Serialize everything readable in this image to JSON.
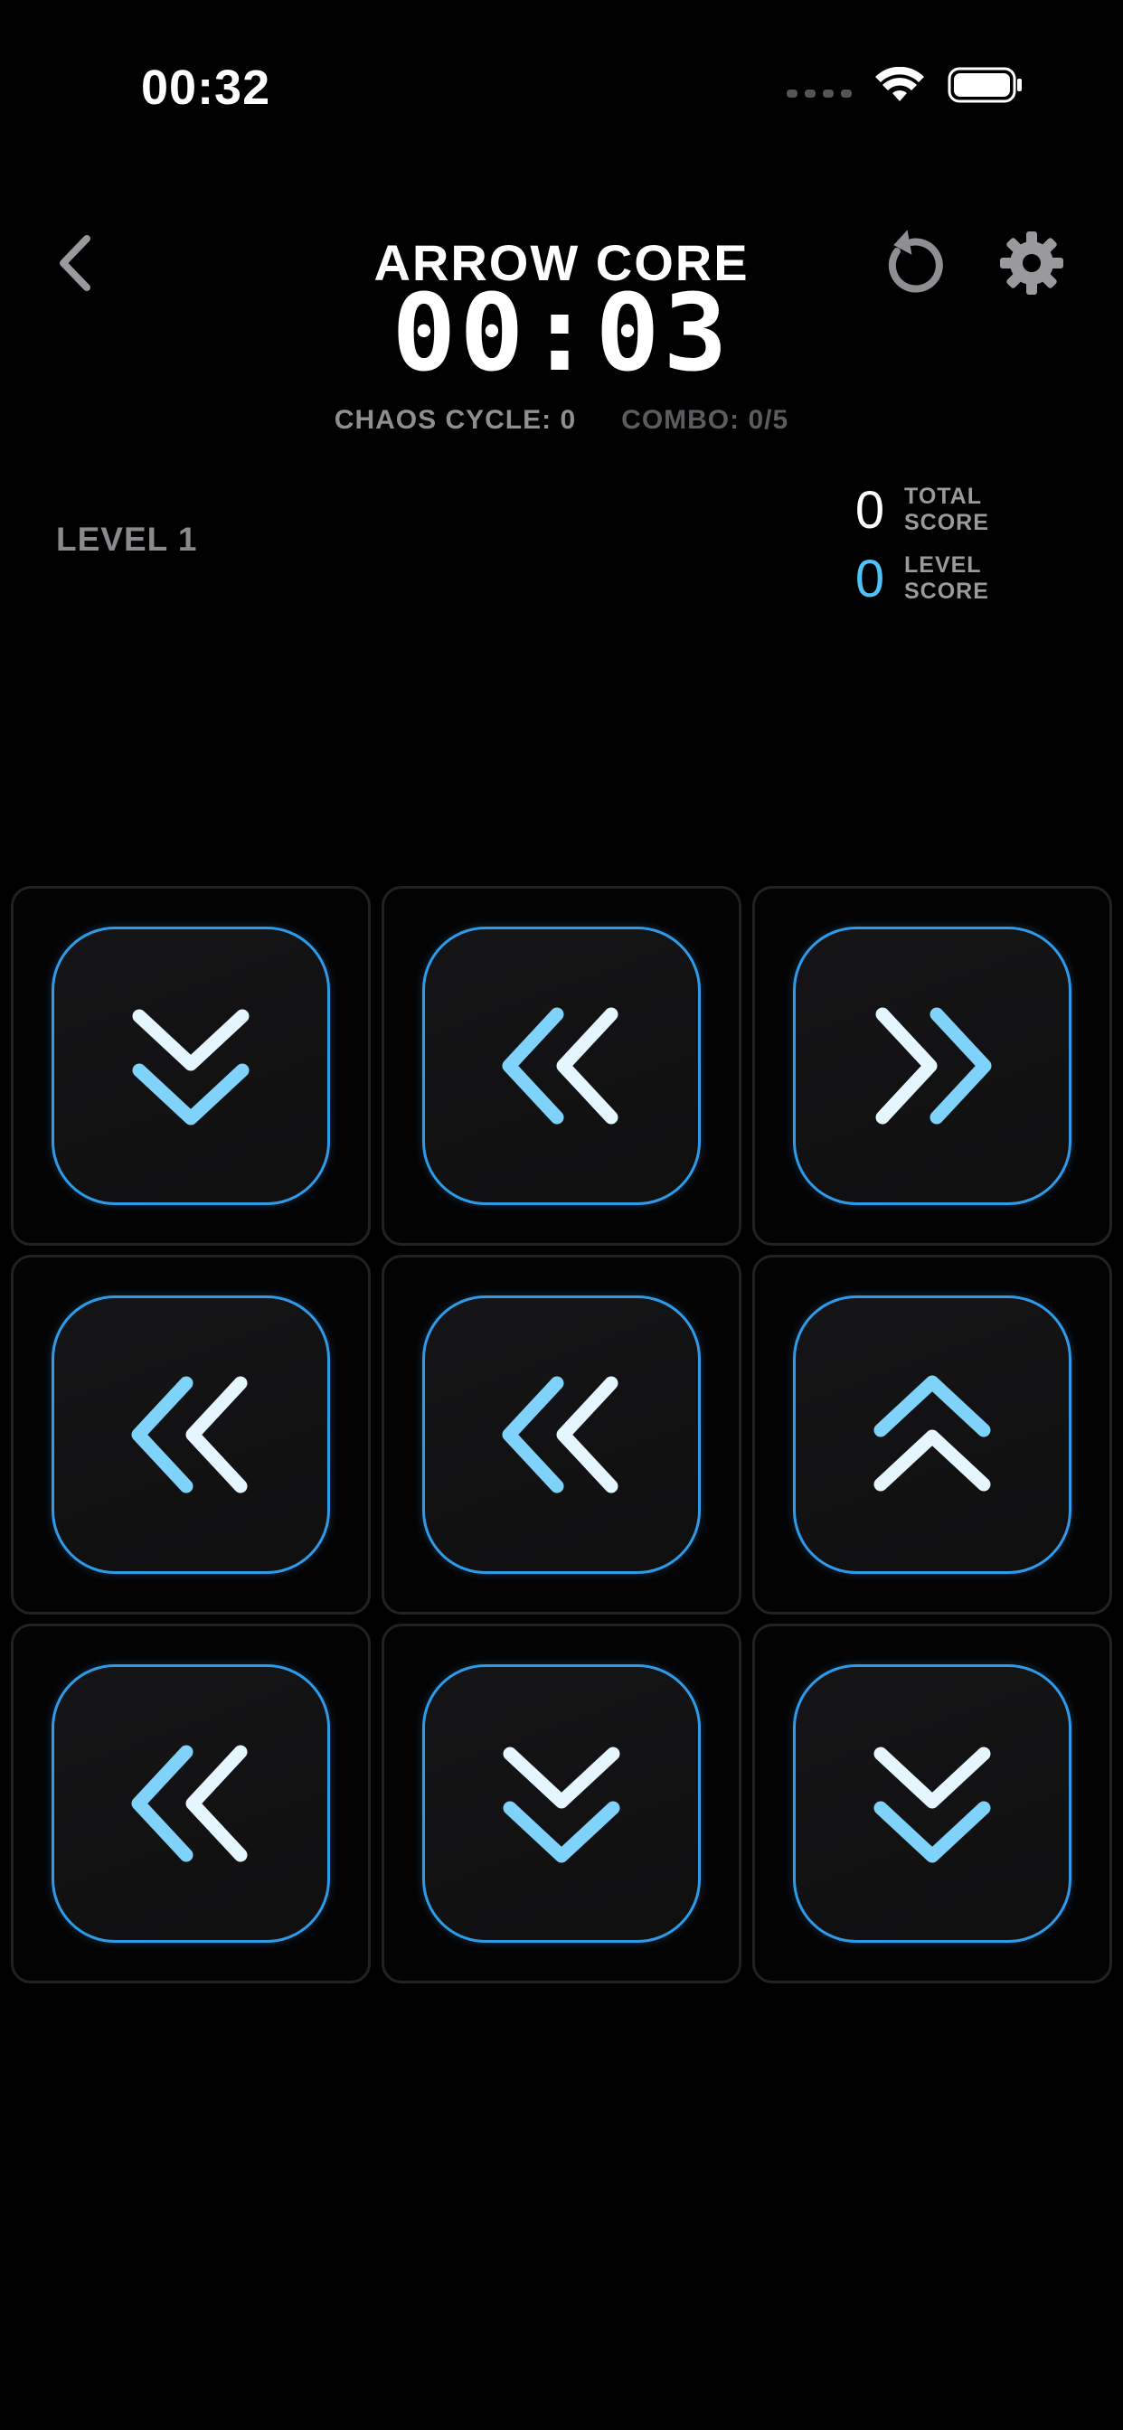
{
  "status_bar": {
    "time": "00:32",
    "icons": [
      "cellular-signal-icon",
      "wifi-icon",
      "battery-icon"
    ]
  },
  "header": {
    "back_icon": "chevron-left-icon",
    "title": "ARROW CORE",
    "timer": "00:03",
    "restart_icon": "restart-icon",
    "settings_icon": "gear-icon"
  },
  "stats": {
    "chaos_cycle": "CHAOS CYCLE: 0",
    "combo": "COMBO: 0/5"
  },
  "level": {
    "label": "LEVEL 1"
  },
  "scores": {
    "total_value": "0",
    "total_label": "TOTAL SCORE",
    "level_value": "0",
    "level_label": "LEVEL SCORE"
  },
  "colors": {
    "background": "#000000",
    "accent": "#4fc3f7",
    "tile_border": "#2f9be8",
    "muted_text": "#8e8e93"
  },
  "grid": {
    "rows": 3,
    "cols": 3,
    "tiles": [
      {
        "direction": "down",
        "icon": "double-chevron-down-icon"
      },
      {
        "direction": "left",
        "icon": "double-chevron-left-icon"
      },
      {
        "direction": "right",
        "icon": "double-chevron-right-icon"
      },
      {
        "direction": "left",
        "icon": "double-chevron-left-icon"
      },
      {
        "direction": "left",
        "icon": "double-chevron-left-icon"
      },
      {
        "direction": "up",
        "icon": "double-chevron-up-icon"
      },
      {
        "direction": "left",
        "icon": "double-chevron-left-icon"
      },
      {
        "direction": "down",
        "icon": "double-chevron-down-icon"
      },
      {
        "direction": "down",
        "icon": "double-chevron-down-icon"
      }
    ]
  }
}
